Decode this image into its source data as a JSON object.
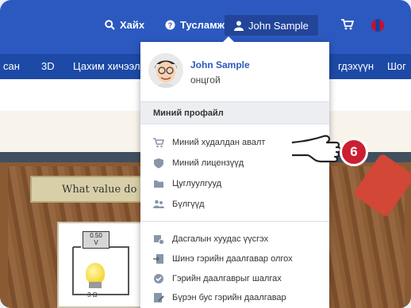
{
  "topbar": {
    "search_label": "Хайх",
    "help_label": "Тусламж",
    "user_label": "John Sample"
  },
  "nav": {
    "items": [
      "сан",
      "3D",
      "Цахим хичээл",
      "гдэхүүн",
      "Шог"
    ]
  },
  "content": {
    "question_text": "What value do",
    "voltmeter_reading": "0.50",
    "voltmeter_unit": "V",
    "bulb_label": "3 Ω"
  },
  "dropdown": {
    "user_name": "John Sample",
    "user_role": "онцгой",
    "section_title": "Миний профайл",
    "items": [
      {
        "label": "Миний худалдан авалт",
        "icon": "cart-icon"
      },
      {
        "label": "Миний лицензүүд",
        "icon": "shield-icon"
      },
      {
        "label": "Цуглуулгууд",
        "icon": "folder-icon"
      },
      {
        "label": "Бүлгүүд",
        "icon": "users-icon"
      },
      {
        "label": "Дасгалын хуудас үүсгэх",
        "icon": "worksheet-icon"
      },
      {
        "label": "Шинэ гэрийн даалгавар олгох",
        "icon": "assign-icon"
      },
      {
        "label": "Гэрийн даалгаврыг шалгах",
        "icon": "check-circle-icon"
      },
      {
        "label": "Бүрэн бус гэрийн даалгавар",
        "icon": "edit-icon"
      }
    ]
  },
  "callout": {
    "number": "6"
  },
  "colors": {
    "topbar": "#2c59bf",
    "navbar": "#1d4aa6",
    "accent": "#2c59bf",
    "badge": "#cc1f31"
  }
}
